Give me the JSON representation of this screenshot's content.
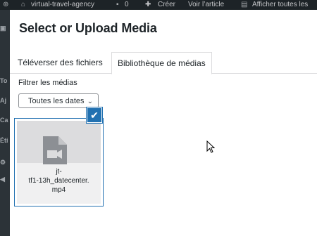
{
  "admin_bar": {
    "site_name": "virtual-travel-agency",
    "comments_count": "0",
    "new_label": "Créer",
    "view_article": "Voir l’article",
    "show_all": "Afficher toutes les"
  },
  "left_menu": {
    "items": [
      "To",
      "Aj",
      "Ca",
      "Éti"
    ]
  },
  "modal": {
    "title": "Select or Upload Media",
    "tabs": [
      {
        "label": "Téléverser des fichiers",
        "active": false
      },
      {
        "label": "Bibliothèque de médias",
        "active": true
      }
    ],
    "filter": {
      "label": "Filtrer les médias",
      "selected": "Toutes les dates"
    },
    "attachments": [
      {
        "filename_line1": "jt-",
        "filename_line2": "tf1-13h_datecenter.",
        "filename_line3": "mp4",
        "selected": true,
        "icon": "video-file-icon"
      }
    ]
  },
  "colors": {
    "admin_bar_bg": "#1d2327",
    "accent": "#2271b1",
    "thumb_bg": "#dcdcde",
    "icon_gray": "#8c8f94"
  }
}
